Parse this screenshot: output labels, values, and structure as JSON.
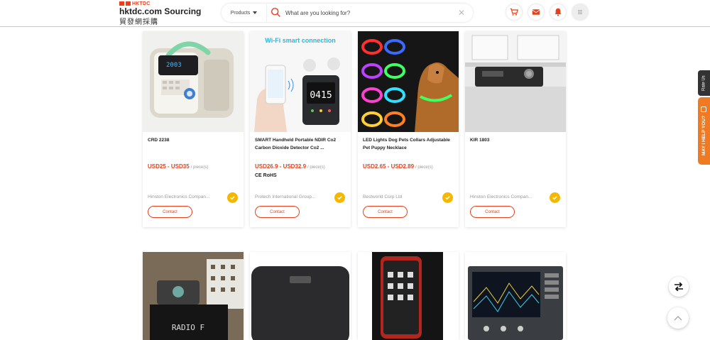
{
  "header": {
    "logo_mark": "HKTDC",
    "brand": "hktdc.com Sourcing",
    "brand_cn": "貿發網採購",
    "category_select": "Products",
    "search_placeholder": "What are you looking for?",
    "icons": [
      "cart-icon",
      "mail-icon",
      "bell-icon",
      "menu-icon"
    ]
  },
  "products": [
    {
      "name": "CRD 2238",
      "price": "USD25 - USD35",
      "unit": "/ piece(s)",
      "cert": "",
      "supplier": "Hinston Electronics Compan...",
      "contact_label": "Contact"
    },
    {
      "name": "SMART Handheld Portable NDIR Co2 Carbon Dioxide Detector Co2 ...",
      "price": "USD26.9 - USD32.9",
      "unit": "/ piece(s)",
      "cert": "CE RoHS",
      "supplier": "Protech International Group...",
      "contact_label": "Contact",
      "image_caption": "Wi-Fi smart connection",
      "display_value": "0415"
    },
    {
      "name": "LED Lights Dog Pets Collars Adjustable Pet Puppy Necklace",
      "price": "USD2.65 - USD2.89",
      "unit": "/ piece(s)",
      "cert": "",
      "supplier": "Bestworld Corp Ltd",
      "contact_label": "Contact"
    },
    {
      "name": "KIR 1803",
      "price": "",
      "unit": "",
      "cert": "",
      "supplier": "Hinston Electronics Compan...",
      "contact_label": "Contact"
    }
  ],
  "row2": {
    "radio_display": "RADIO F"
  },
  "side": {
    "rate_us": "Rate Us",
    "may_help": "MAY I HELP YOU?"
  },
  "colors": {
    "accent": "#e8401c",
    "verified": "#f5b800",
    "help": "#f07a22"
  }
}
